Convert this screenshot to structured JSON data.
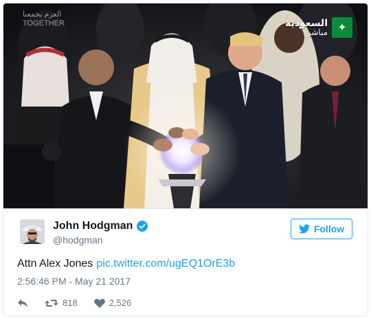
{
  "media": {
    "channel_name": "السعودية",
    "channel_sub": "مباشر",
    "watermark_line1": "العزم يجمعنا",
    "watermark_line2": "TOGETHER"
  },
  "author": {
    "display_name": "John Hodgman",
    "handle": "@hodgman",
    "verified_icon": "verified-badge-icon"
  },
  "follow_button": {
    "label": "Follow",
    "icon": "twitter-bird-icon"
  },
  "tweet": {
    "text": "Attn Alex Jones",
    "link": "pic.twitter.com/ugEQ1OrE3b",
    "timestamp": "2:56:46 PM - May 21 2017"
  },
  "actions": {
    "reply_icon": "reply-icon",
    "retweet_icon": "retweet-icon",
    "retweet_count": "818",
    "like_icon": "heart-icon",
    "like_count": "2,526"
  },
  "colors": {
    "accent": "#1da1f2",
    "muted": "#657786",
    "text": "#14171a",
    "border": "#e1e8ed"
  }
}
